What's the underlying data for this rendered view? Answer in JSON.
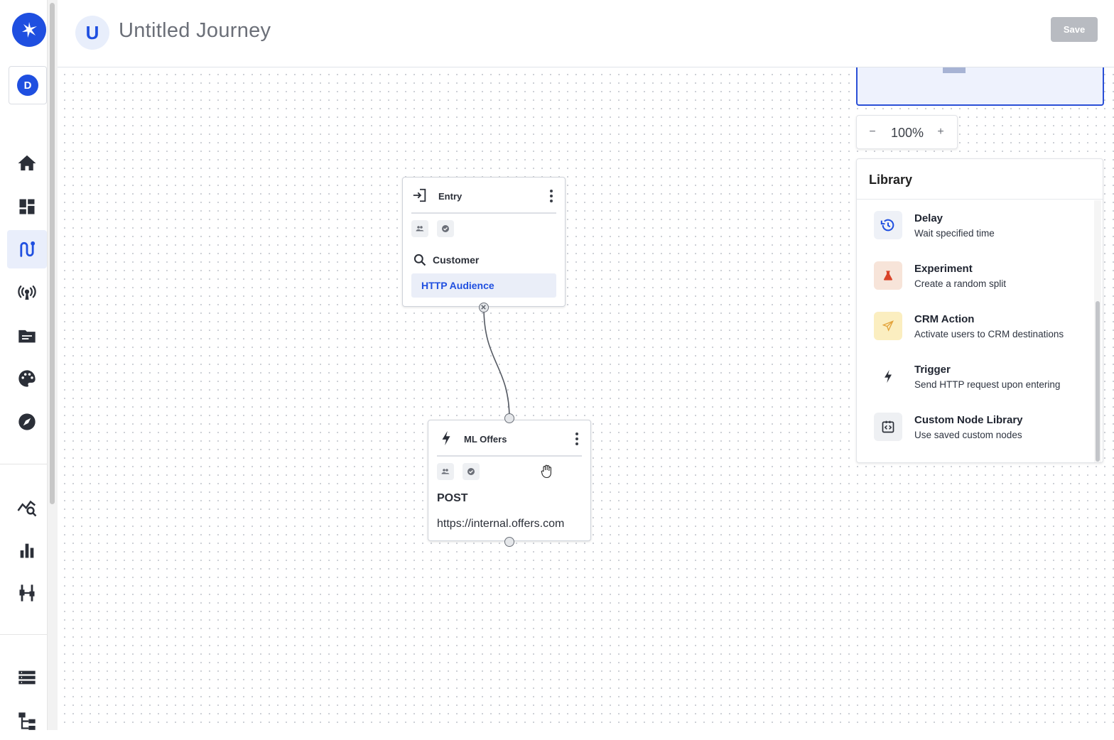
{
  "rail": {
    "account_initial": "D",
    "nav_icons": [
      "home-icon",
      "dashboard-icon",
      "journey-icon",
      "broadcast-icon",
      "folder-icon",
      "palette-icon",
      "compass-icon",
      "analytics-icon",
      "bar-chart-icon",
      "sliders-icon",
      "list-icon",
      "hierarchy-icon"
    ],
    "active_item": "journey-icon"
  },
  "header": {
    "avatar_initial": "U",
    "title": "Untitled Journey",
    "save_label": "Save"
  },
  "zoom": {
    "minus": "−",
    "value": "100%",
    "plus": "+"
  },
  "nodes": {
    "entry": {
      "title": "Entry",
      "target_label": "Customer",
      "audience": "HTTP Audience"
    },
    "ml_offers": {
      "title": "ML Offers",
      "method": "POST",
      "url": "https://internal.offers.com"
    }
  },
  "library": {
    "title": "Library",
    "items": [
      {
        "name": "Delay",
        "desc": "Wait specified time",
        "icon": "history-icon",
        "bg": "#eef1f7"
      },
      {
        "name": "Experiment",
        "desc": "Create a random split",
        "icon": "flask-icon",
        "bg": "#f7e4d9"
      },
      {
        "name": "CRM Action",
        "desc": "Activate users to CRM destinations",
        "icon": "send-icon",
        "bg": "#fbeec0"
      },
      {
        "name": "Trigger",
        "desc": "Send HTTP request upon entering",
        "icon": "bolt-icon",
        "bg": "#ffffff"
      },
      {
        "name": "Custom Node Library",
        "desc": "Use saved custom nodes",
        "icon": "code-box-icon",
        "bg": "#eef0f3"
      }
    ]
  },
  "colors": {
    "brand": "#1f4fe0",
    "accent_bg": "#e9eefb",
    "save_disabled": "#b8bbc1"
  }
}
